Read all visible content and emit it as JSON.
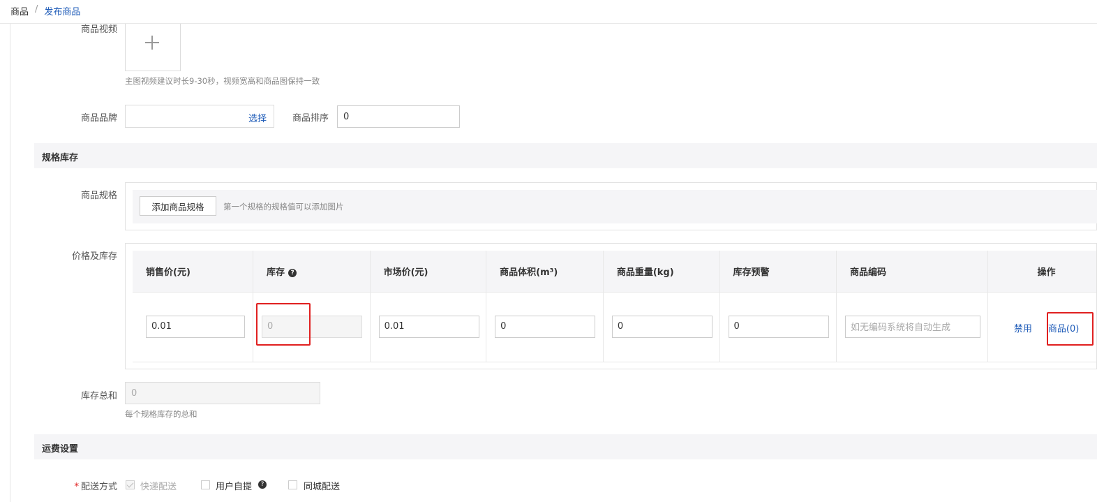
{
  "breadcrumb": {
    "root": "商品",
    "separator": "/",
    "current": "发布商品"
  },
  "video": {
    "label": "商品视频",
    "hint": "主图视频建议时长9-30秒，视频宽高和商品图保持一致"
  },
  "brand": {
    "label": "商品品牌",
    "pick": "选择"
  },
  "sort": {
    "label": "商品排序",
    "value": "0"
  },
  "spec_section": {
    "title": "规格库存"
  },
  "spec": {
    "label": "商品规格",
    "add_button": "添加商品规格",
    "hint": "第一个规格的规格值可以添加图片"
  },
  "price_stock": {
    "label": "价格及库存",
    "headers": [
      "销售价(元)",
      "库存",
      "市场价(元)",
      "商品体积(m³)",
      "商品重量(kg)",
      "库存预警",
      "商品编码",
      "操作"
    ],
    "row": {
      "sale_price": "0.01",
      "stock": "0",
      "market_price": "0.01",
      "volume": "0",
      "weight": "0",
      "stock_warning": "0",
      "code_placeholder": "如无编码系统将自动生成",
      "disable_link": "禁用",
      "goods_link": "商品(0)"
    },
    "stock_help_icon": "question-circle-icon"
  },
  "stock_total": {
    "label": "库存总和",
    "value": "0",
    "hint": "每个规格库存的总和"
  },
  "shipping_section": {
    "title": "运费设置"
  },
  "delivery": {
    "label": "配送方式",
    "required_mark": "*",
    "options": [
      {
        "label": "快递配送",
        "checked": true,
        "disabled": true
      },
      {
        "label": "用户自提",
        "checked": false,
        "disabled": false,
        "help": "question-circle-icon"
      },
      {
        "label": "同城配送",
        "checked": false,
        "disabled": false
      }
    ]
  },
  "colors": {
    "link": "#1e5bb8",
    "highlight": "#e02020",
    "section_bg": "#f5f5f7"
  }
}
